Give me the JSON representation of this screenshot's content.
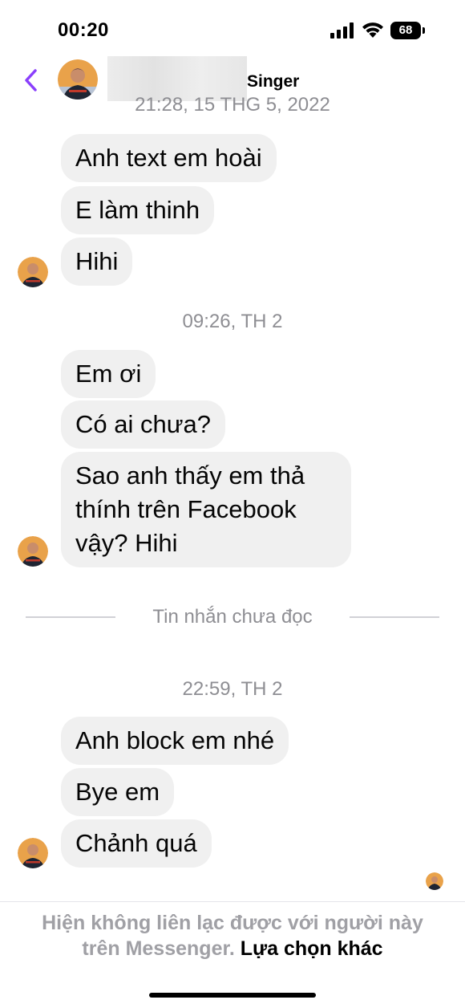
{
  "status_bar": {
    "time": "00:20",
    "battery": "68"
  },
  "header": {
    "contact_name": "Singer"
  },
  "messages_section_1": {
    "timestamp": "21:28, 15 THG 5, 2022",
    "bubbles": [
      "Anh text em hoài",
      "E làm thinh",
      "Hihi"
    ]
  },
  "messages_section_2": {
    "timestamp": "09:26, TH 2",
    "bubbles": [
      "Em ơi",
      "Có ai chưa?",
      "Sao anh thấy em thả thính trên Facebook vậy? Hihi"
    ]
  },
  "unread_divider": {
    "label": "Tin nhắn chưa đọc"
  },
  "messages_section_3": {
    "timestamp": "22:59, TH 2",
    "bubbles": [
      "Anh block em nhé",
      "Bye em",
      "Chảnh quá"
    ]
  },
  "footer": {
    "notice": "Hiện không liên lạc được với người này trên Messenger.",
    "link": "Lựa chọn khác"
  },
  "colors": {
    "accent": "#8a3ffc",
    "bubble": "#f0f0f0",
    "muted": "#8e8e93"
  },
  "icons": [
    "back-chevron-icon",
    "signal-icon",
    "wifi-icon",
    "battery-icon",
    "avatar"
  ]
}
